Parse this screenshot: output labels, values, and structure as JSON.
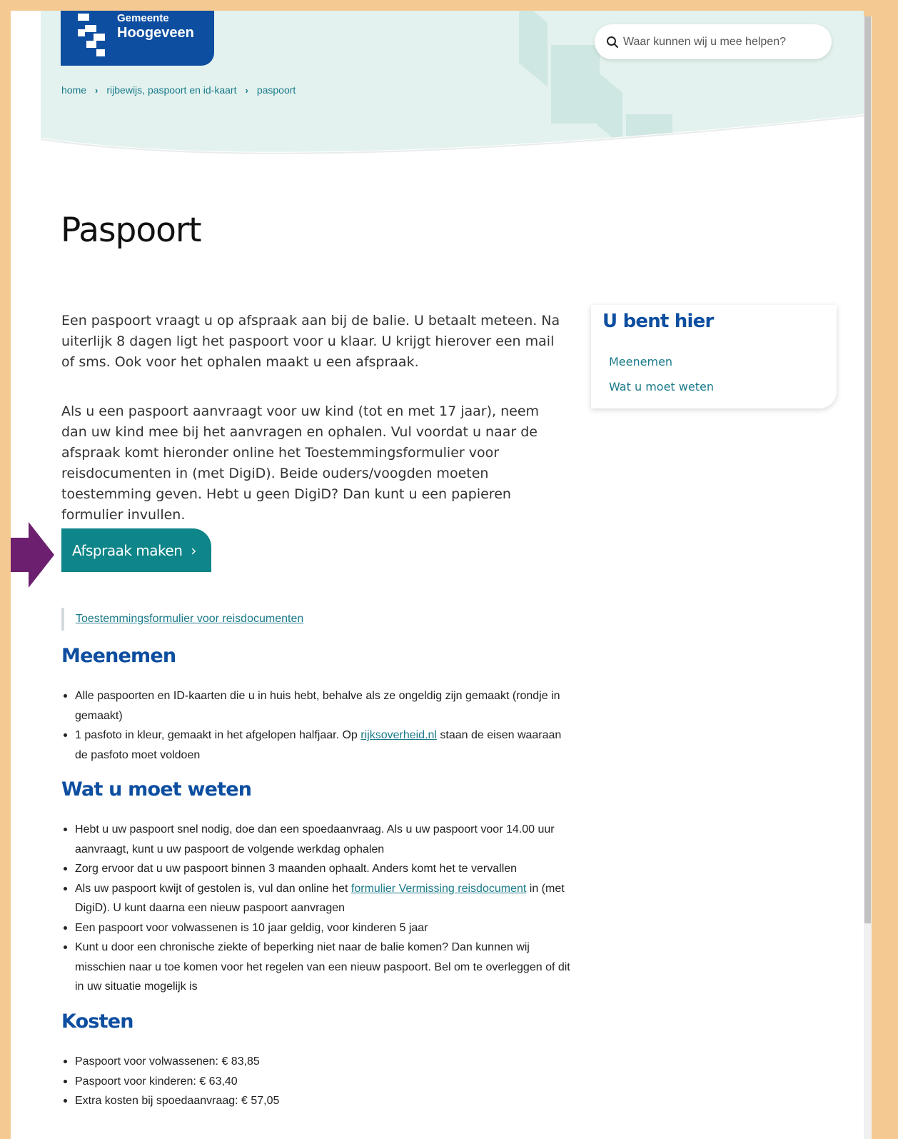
{
  "header": {
    "logo": {
      "line1": "Gemeente",
      "line2": "Hoogeveen"
    },
    "search": {
      "placeholder": "Waar kunnen wij u mee helpen?"
    },
    "breadcrumb": [
      {
        "label": "home"
      },
      {
        "label": "rijbewijs, paspoort en id-kaart"
      },
      {
        "label": "paspoort"
      }
    ]
  },
  "main": {
    "title": "Paspoort",
    "intro": [
      "Een paspoort vraagt u op afspraak aan bij de balie. U betaalt meteen. Na uiterlijk 8 dagen ligt het paspoort voor u klaar. U krijgt hierover een mail of sms. Ook voor het ophalen maakt u een afspraak.",
      "Als u een paspoort aanvraagt voor uw kind (tot en met 17 jaar), neem dan uw kind mee bij het aanvragen en ophalen. Vul voordat u naar de afspraak komt hieronder online het Toestemmingsformulier voor reisdocumenten in (met DigiD). Beide ouders/voogden moeten toestemming geven. Hebt u geen DigiD? Dan kunt u een papieren formulier invullen."
    ],
    "cta": {
      "label": "Afspraak maken",
      "chevron": "›"
    },
    "consent_link": "Toestemmingsformulier voor reisdocumenten",
    "sections": {
      "meenemen": {
        "heading": "Meenemen",
        "items": [
          {
            "text": "Alle paspoorten en ID-kaarten die u in huis hebt, behalve als ze ongeldig zijn gemaakt (rondje in gemaakt)"
          },
          {
            "before": "1 pasfoto in kleur, gemaakt in het afgelopen halfjaar. Op ",
            "link": "rijksoverheid.nl",
            "after": " staan de eisen waaraan de pasfoto moet voldoen"
          }
        ]
      },
      "weten": {
        "heading": "Wat u moet weten",
        "items": [
          {
            "text": "Hebt u uw paspoort snel nodig, doe dan een spoedaanvraag. Als u uw paspoort voor 14.00 uur aanvraagt, kunt u uw paspoort de volgende werkdag ophalen"
          },
          {
            "text": "Zorg ervoor dat u uw paspoort binnen 3 maanden ophaalt. Anders komt het te vervallen"
          },
          {
            "before": "Als uw paspoort kwijt of gestolen is, vul dan online het ",
            "link": "formulier Vermissing reisdocument",
            "after": " in (met DigiD). U kunt daarna een nieuw paspoort aanvragen"
          },
          {
            "text": "Een paspoort voor volwassenen is 10 jaar geldig, voor kinderen 5 jaar"
          },
          {
            "text": "Kunt u door een chronische ziekte of beperking niet naar de balie komen? Dan kunnen wij misschien naar u toe komen voor het regelen van een nieuw paspoort. Bel om te overleggen of dit in uw situatie mogelijk is"
          }
        ]
      },
      "kosten": {
        "heading": "Kosten",
        "items": [
          {
            "text": "Paspoort voor volwassenen: € 83,85"
          },
          {
            "text": "Paspoort voor kinderen: € 63,40"
          },
          {
            "text": "Extra kosten bij spoedaanvraag: € 57,05"
          }
        ]
      }
    }
  },
  "sidebar": {
    "title": "U bent hier",
    "links": [
      {
        "label": "Meenemen"
      },
      {
        "label": "Wat u moet weten"
      }
    ]
  },
  "colors": {
    "brand_blue": "#0d4ea0",
    "teal": "#0d8589",
    "link": "#1a7a8a",
    "header_bg": "#e3f2ee",
    "frame": "#f5c992",
    "arrow": "#6b1f6e"
  }
}
